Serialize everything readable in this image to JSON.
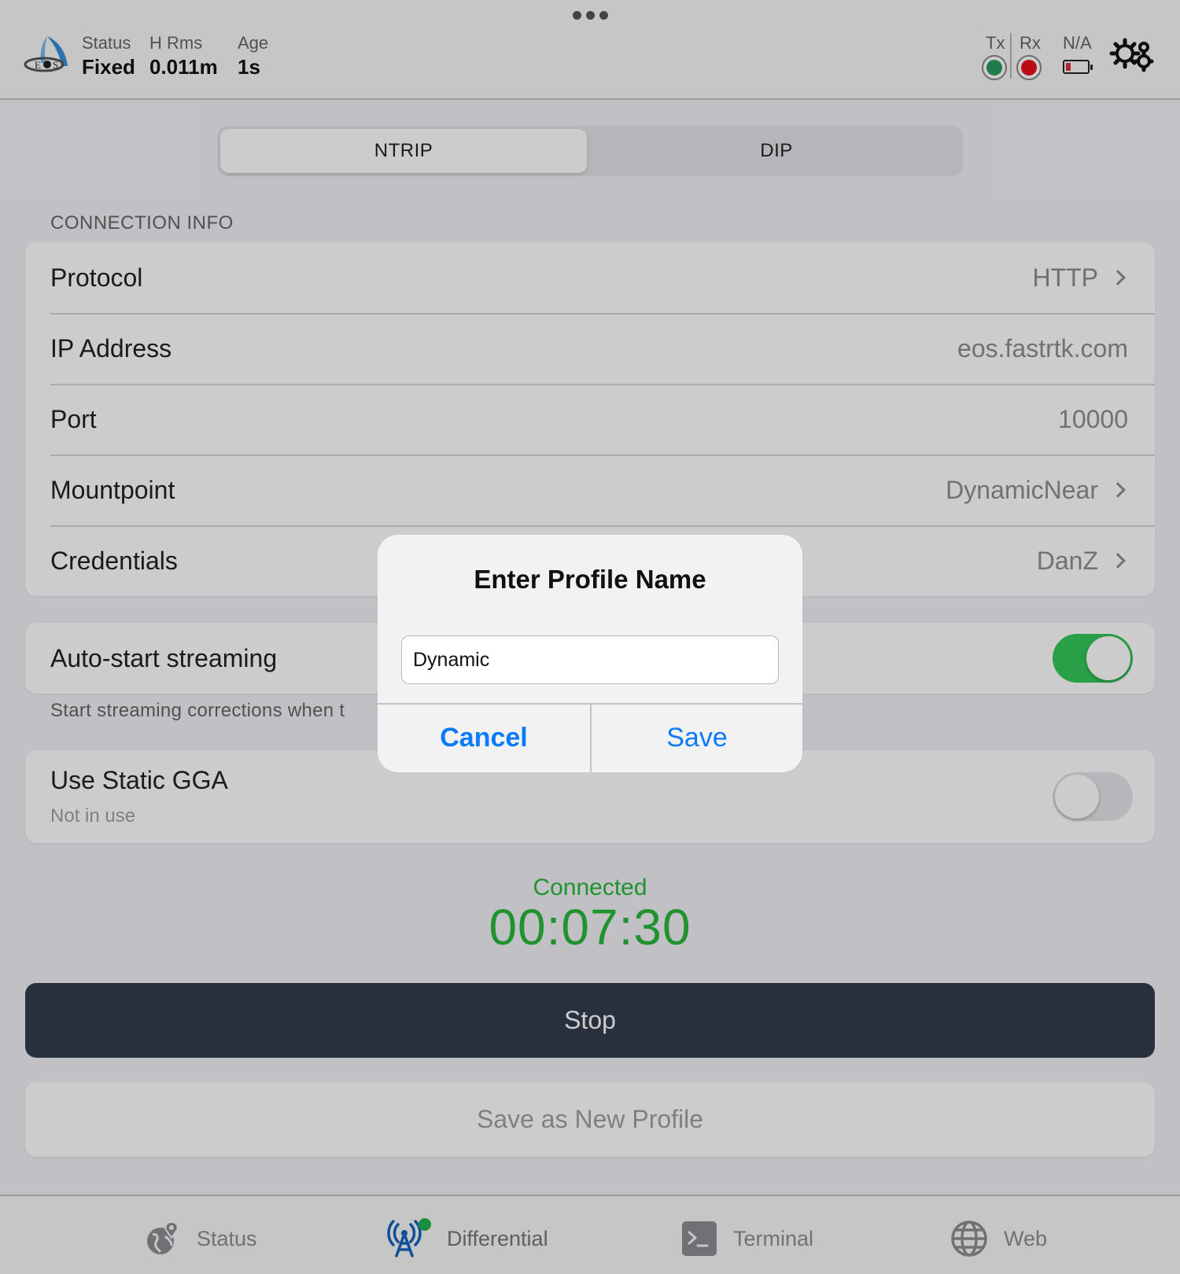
{
  "header": {
    "status": {
      "label": "Status",
      "value": "Fixed"
    },
    "hrms": {
      "label": "H Rms",
      "value": "0.011m"
    },
    "age": {
      "label": "Age",
      "value": "1s"
    },
    "tx_label": "Tx",
    "rx_label": "Rx",
    "battery_label": "N/A",
    "colors": {
      "tx": "#2a9b5e",
      "rx": "#e8101a",
      "battery_low": "#dd3333"
    }
  },
  "segments": {
    "ntrip": "NTRIP",
    "dip": "DIP",
    "selected": "NTRIP"
  },
  "connection": {
    "section_title": "CONNECTION INFO",
    "rows": [
      {
        "name": "Protocol",
        "value": "HTTP"
      },
      {
        "name": "IP Address",
        "value": "eos.fastrtk.com"
      },
      {
        "name": "Port",
        "value": "10000"
      },
      {
        "name": "Mountpoint",
        "value": "DynamicNear"
      },
      {
        "name": "Credentials",
        "value": "DanZ"
      }
    ]
  },
  "autostart": {
    "label": "Auto-start streaming",
    "on": true,
    "footnote": "Start streaming corrections when t"
  },
  "static_gga": {
    "label": "Use Static GGA",
    "sublabel": "Not in use",
    "on": false
  },
  "status": {
    "label": "Connected",
    "timer": "00:07:30",
    "color": "#28b83c"
  },
  "buttons": {
    "stop": "Stop",
    "save_profile": "Save as New Profile"
  },
  "tabs": [
    {
      "label": "Status",
      "icon": "globe-pin-icon"
    },
    {
      "label": "Differential",
      "icon": "antenna-tower-icon",
      "active": true
    },
    {
      "label": "Terminal",
      "icon": "terminal-icon"
    },
    {
      "label": "Web",
      "icon": "globe-icon"
    }
  ],
  "dialog": {
    "title": "Enter Profile Name",
    "input_value": "Dynamic",
    "cancel": "Cancel",
    "save": "Save",
    "accent": "#0a7aff"
  }
}
